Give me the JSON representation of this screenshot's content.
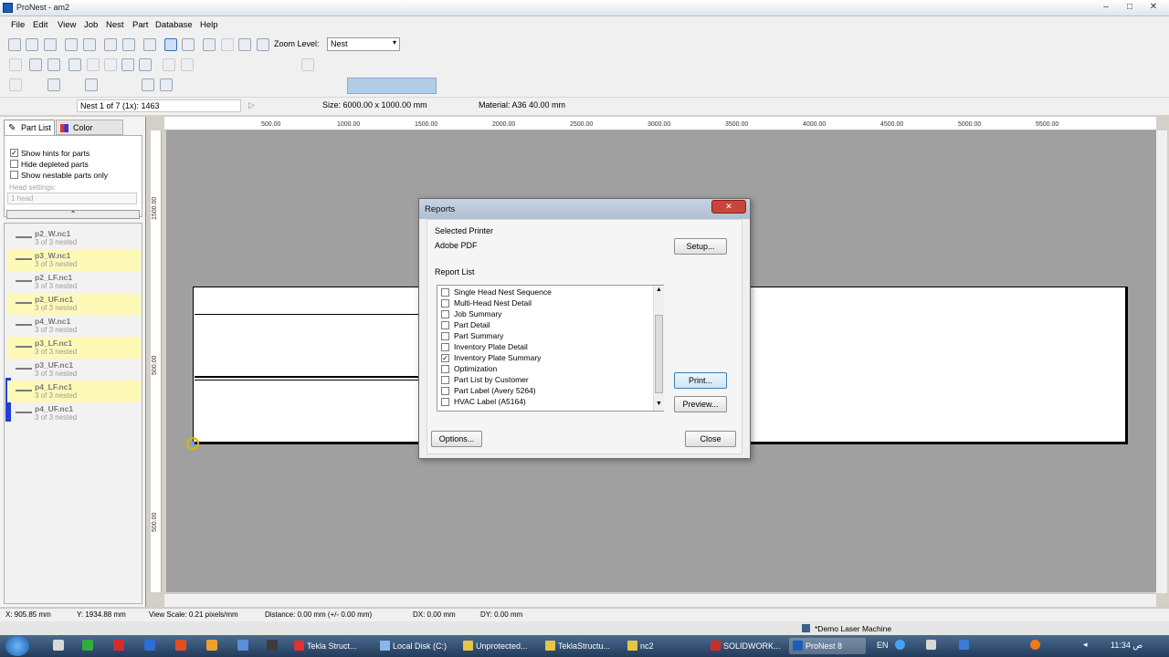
{
  "window": {
    "title": "ProNest - am2",
    "controls": [
      "–",
      "□",
      "✕"
    ]
  },
  "menu": [
    "File",
    "Edit",
    "View",
    "Job",
    "Nest",
    "Part",
    "Database",
    "Help"
  ],
  "toolbar": {
    "zoom_label": "Zoom Level:",
    "zoom_value": "Nest"
  },
  "infobar": {
    "nest": "Nest 1 of 7 (1x): 1463",
    "size": "Size: 6000.00 x 1000.00 mm",
    "material": "Material: A36 40.00 mm"
  },
  "left_panel": {
    "tabs": [
      "Part List",
      "Color Legend"
    ],
    "options": [
      {
        "label": "Show hints for parts",
        "checked": true
      },
      {
        "label": "Hide depleted parts",
        "checked": false
      },
      {
        "label": "Show nestable parts only",
        "checked": false
      }
    ],
    "head_settings_label": "Head settings:",
    "head_settings_value": "1 head",
    "parts": [
      {
        "name": "p2_W.nc1",
        "sub": "3 of 3 nested",
        "highlight": false
      },
      {
        "name": "p3_W.nc1",
        "sub": "3 of 3 nested",
        "highlight": true
      },
      {
        "name": "p2_LF.nc1",
        "sub": "3 of 3 nested",
        "highlight": false
      },
      {
        "name": "p2_UF.nc1",
        "sub": "3 of 3 nested",
        "highlight": true
      },
      {
        "name": "p4_W.nc1",
        "sub": "3 of 3 nested",
        "highlight": false
      },
      {
        "name": "p3_LF.nc1",
        "sub": "3 of 3 nested",
        "highlight": true
      },
      {
        "name": "p3_UF.nc1",
        "sub": "3 of 3 nested",
        "highlight": false
      },
      {
        "name": "p4_LF.nc1",
        "sub": "3 of 3 nested",
        "highlight": true
      },
      {
        "name": "p4_UF.nc1",
        "sub": "3 of 3 nested",
        "highlight": false
      }
    ]
  },
  "ruler": {
    "top": [
      "500.00",
      "1000.00",
      "1500.00",
      "2000.00",
      "2500.00",
      "3000.00",
      "3500.00",
      "4000.00",
      "4500.00",
      "5000.00",
      "5500.00"
    ],
    "left": [
      "1500.00",
      "500.00",
      "500.00"
    ]
  },
  "dialog": {
    "title": "Reports",
    "selected_printer_label": "Selected Printer",
    "printer": "Adobe PDF",
    "setup": "Setup...",
    "report_list_label": "Report List",
    "reports": [
      {
        "label": "Single Head Nest Sequence",
        "checked": false
      },
      {
        "label": "Multi-Head Nest Detail",
        "checked": false
      },
      {
        "label": "Job Summary",
        "checked": false
      },
      {
        "label": "Part Detail",
        "checked": false
      },
      {
        "label": "Part Summary",
        "checked": false
      },
      {
        "label": "Inventory Plate Detail",
        "checked": false
      },
      {
        "label": "Inventory Plate Summary",
        "checked": true
      },
      {
        "label": "Optimization",
        "checked": false
      },
      {
        "label": "Part List by Customer",
        "checked": false
      },
      {
        "label": "Part Label (Avery 5264)",
        "checked": false
      },
      {
        "label": "HVAC Label (A5164)",
        "checked": false
      }
    ],
    "print": "Print...",
    "preview": "Preview...",
    "options": "Options...",
    "close": "Close"
  },
  "status": {
    "x": "X: 905.85 mm",
    "y": "Y: 1934.88 mm",
    "scale": "View Scale: 0.21 pixels/mm",
    "distance": "Distance: 0.00 mm (+/- 0.00 mm)",
    "dx": "DX: 0.00 mm",
    "dy": "DY: 0.00 mm",
    "machine": "*Demo Laser Machine"
  },
  "taskbar": {
    "items": [
      "Tekla Struct...",
      "Local Disk (C:)",
      "Unprotected...",
      "TeklaStructu...",
      "nc2",
      "SOLIDWORK...",
      "ProNest 8"
    ],
    "lang": "EN",
    "clock": "11:34 ص"
  }
}
